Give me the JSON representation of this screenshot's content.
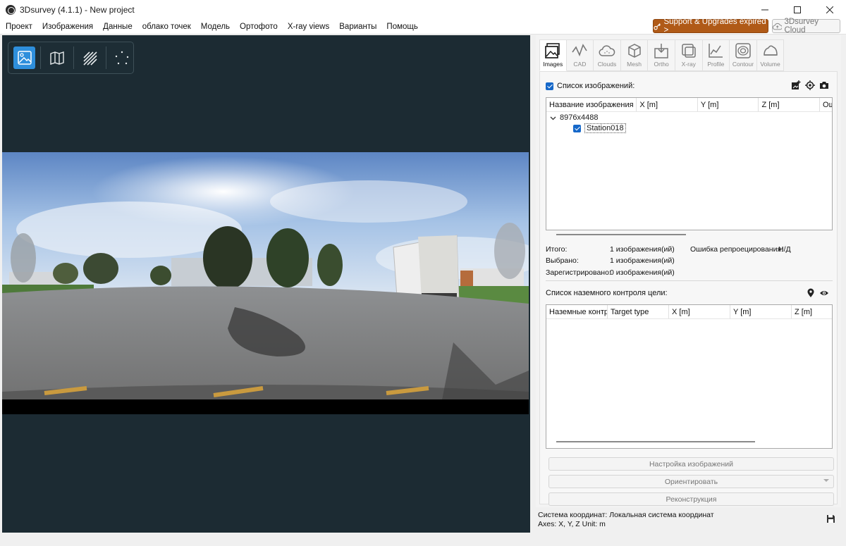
{
  "window": {
    "title": "3Dsurvey (4.1.1) - New project"
  },
  "menu": {
    "items": [
      "Проект",
      "Изображения",
      "Данные",
      "облако точек",
      "Модель",
      "Ортофото",
      "X-ray views",
      "Варианты",
      "Помощь"
    ],
    "support_label": "Support & Upgrades expired >",
    "cloud_label": "3Dsurvey Cloud"
  },
  "tabs": [
    {
      "label": "Images",
      "icon": "images-icon"
    },
    {
      "label": "CAD",
      "icon": "cad-icon"
    },
    {
      "label": "Clouds",
      "icon": "cloud-icon"
    },
    {
      "label": "Mesh",
      "icon": "mesh-cube-icon"
    },
    {
      "label": "Ortho",
      "icon": "ortho-icon"
    },
    {
      "label": "X-ray",
      "icon": "xray-icon"
    },
    {
      "label": "Profile",
      "icon": "profile-chart-icon"
    },
    {
      "label": "Contour",
      "icon": "contour-icon"
    },
    {
      "label": "Volume",
      "icon": "volume-icon"
    }
  ],
  "images": {
    "header": "Список изображений:",
    "columns": [
      "Название изображения",
      "X [m]",
      "Y [m]",
      "Z [m]",
      "Ош"
    ],
    "group": "8976x4488",
    "item": "Station018"
  },
  "stats": {
    "total_label": "Итого:",
    "total_value": "1 изображения(ий)",
    "reproj_label": "Ошибка репроецирования:",
    "reproj_value": "Н/Д",
    "selected_label": "Выбрано:",
    "selected_value": "1 изображения(ий)",
    "registered_label": "Зарегистрировано:",
    "registered_value": "0 изображения(ий)"
  },
  "gcp": {
    "header": "Список наземного контроля цели:",
    "columns": [
      "Наземные контр",
      "Target type",
      "X [m]",
      "Y [m]",
      "Z [m]"
    ]
  },
  "buttons": {
    "setup": "Настройка изображений",
    "orient": "Ориентировать",
    "reconstruct": "Реконструкция"
  },
  "coords": {
    "system": "Система координат: Локальная система координат",
    "axes": "Axes: X, Y, Z Unit: m"
  },
  "colors": {
    "accent": "#1668c9",
    "support": "#b05a17",
    "viewport": "#1c2b33",
    "view_active": "#2e8fdc"
  }
}
